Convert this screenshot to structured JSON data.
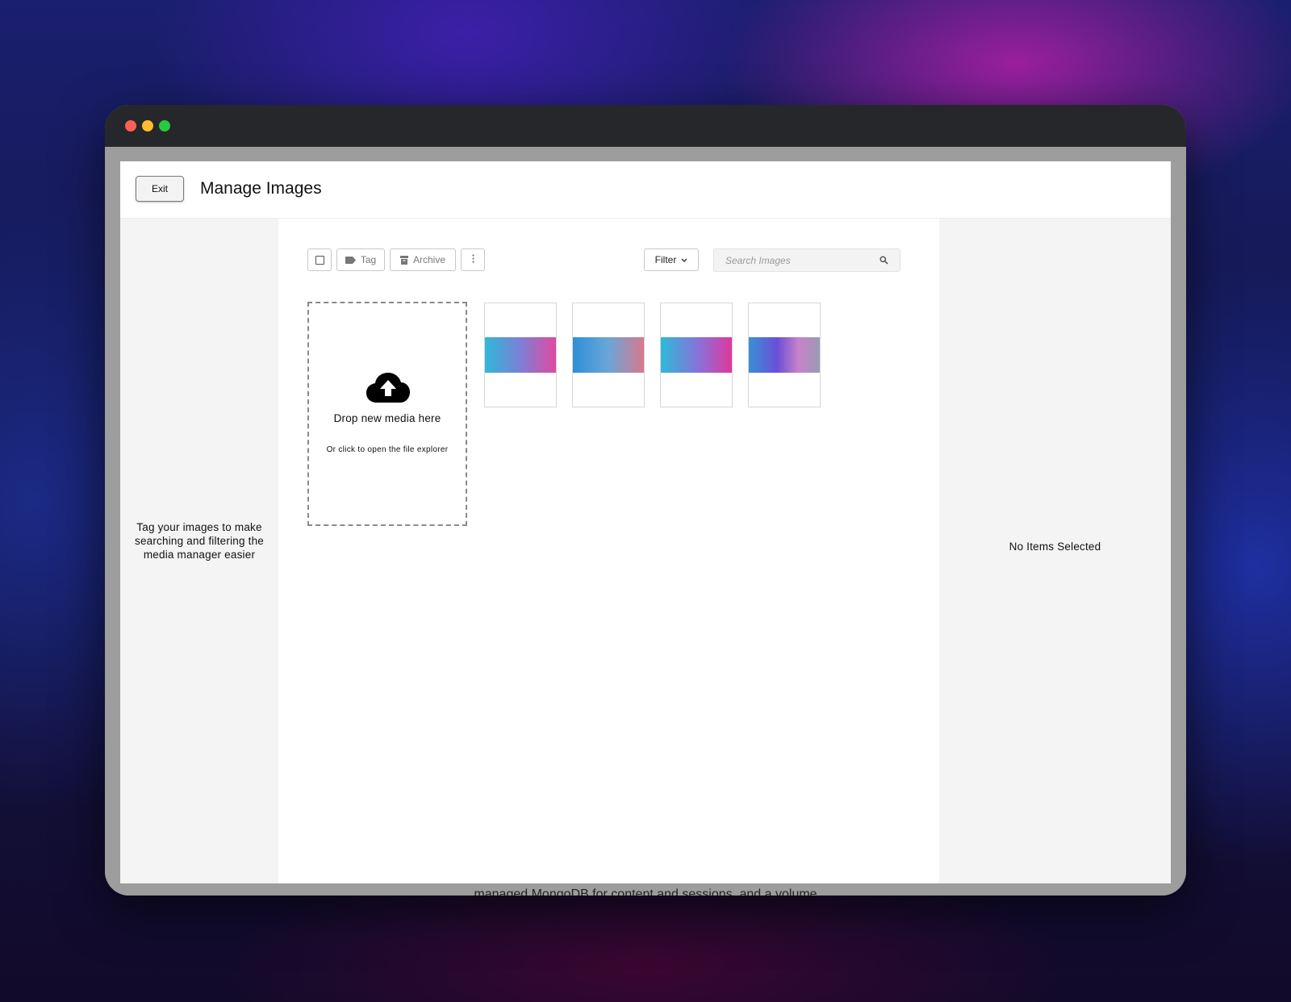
{
  "window": {
    "background_text": "managed MongoDB for content and sessions, and a volume"
  },
  "modal": {
    "exit_label": "Exit",
    "title": "Manage Images"
  },
  "left_panel": {
    "hint": "Tag your images to make searching and filtering the media manager easier"
  },
  "toolbar": {
    "select_all_icon": "checkbox-icon",
    "tag_label": "Tag",
    "tag_icon": "tag-icon",
    "archive_label": "Archive",
    "archive_icon": "archive-icon",
    "more_icon": "more-vertical-icon",
    "filter_label": "Filter",
    "filter_icon": "chevron-down-icon",
    "search_placeholder": "Search Images",
    "search_icon": "search-icon"
  },
  "dropzone": {
    "icon": "cloud-upload-icon",
    "title": "Drop new media here",
    "subtitle": "Or click to open the file explorer"
  },
  "images": [
    {
      "kind": "gradient",
      "colors": [
        "#2fb8d8",
        "#7d7fd6",
        "#e04aa0"
      ]
    },
    {
      "kind": "gradient",
      "colors": [
        "#2e8fd6",
        "#6aa6d8",
        "#d8788c"
      ]
    },
    {
      "kind": "gradient",
      "colors": [
        "#2dbad9",
        "#8c6fd8",
        "#e0389c"
      ]
    },
    {
      "kind": "gradient",
      "colors": [
        "#3a8fd6",
        "#6b4fd8",
        "#c782c8",
        "#9a9ab6"
      ]
    }
  ],
  "right_panel": {
    "empty_text": "No Items Selected"
  },
  "colors": {
    "titlebar": "#26272b",
    "panel_bg": "#f4f4f4",
    "traffic_red": "#fe5f57",
    "traffic_yellow": "#febc2e",
    "traffic_green": "#28c840"
  }
}
